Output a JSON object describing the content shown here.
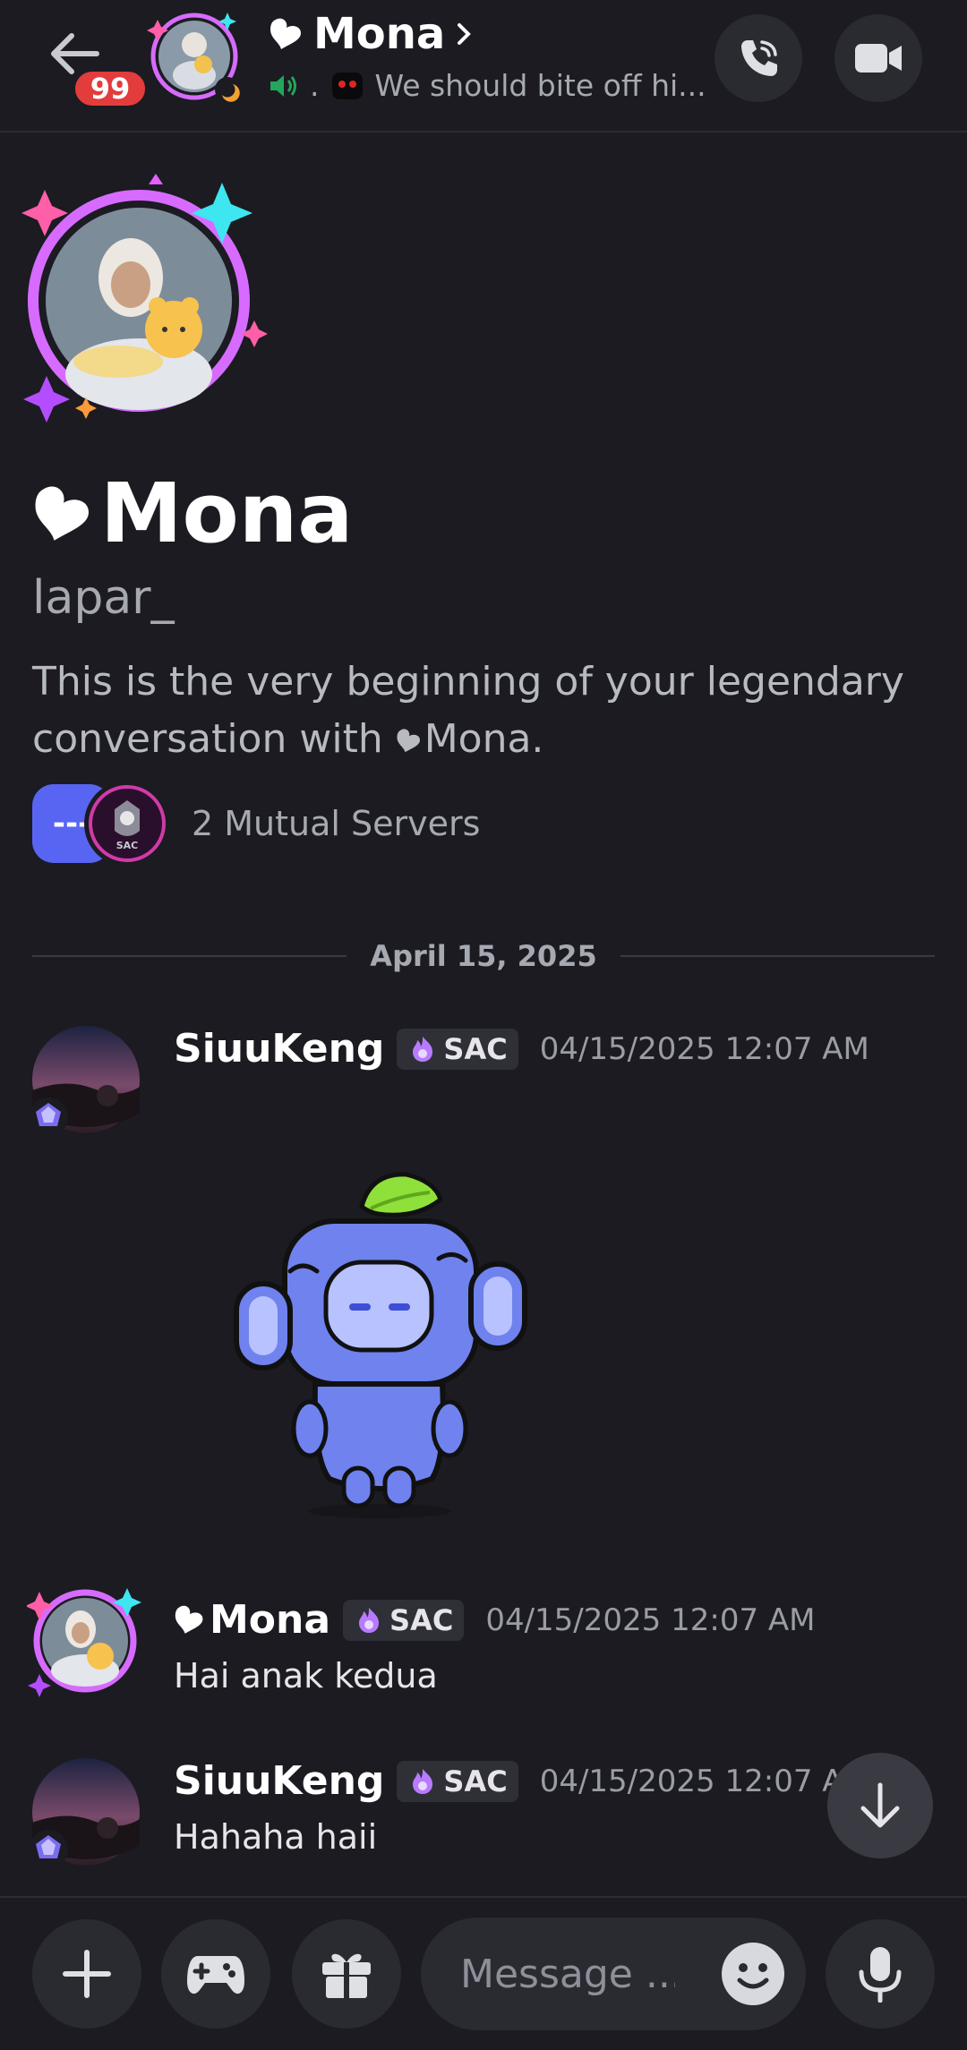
{
  "header": {
    "unread_badge": "99",
    "name": "Mona",
    "status_text": "We should bite off hi...",
    "status_sep": "."
  },
  "profile": {
    "name": "Mona",
    "username": "lapar_",
    "intro_prefix": "This is the very beginning of your legendary conversation with ",
    "intro_name": "Mona.",
    "mutual_servers": "2 Mutual Servers",
    "server1_label": "---"
  },
  "divider": {
    "date": "April 15, 2025"
  },
  "messages": [
    {
      "author": "SiuuKeng",
      "tag": "SAC",
      "timestamp": "04/15/2025 12:07 AM",
      "text": ""
    },
    {
      "author": "Mona",
      "tag": "SAC",
      "timestamp": "04/15/2025 12:07 AM",
      "text": "Hai anak kedua"
    },
    {
      "author": "SiuuKeng",
      "tag": "SAC",
      "timestamp": "04/15/2025 12:07 AM",
      "text": "Hahaha haii"
    }
  ],
  "composer": {
    "placeholder": "Message ..."
  },
  "icons": {
    "back": "arrow-left-icon",
    "call": "phone-icon",
    "video": "video-camera-icon",
    "plus": "plus-icon",
    "game": "gamepad-icon",
    "gift": "gift-icon",
    "emoji": "smiley-icon",
    "mic": "microphone-icon",
    "scroll": "arrow-down-icon"
  },
  "colors": {
    "background": "#1b1b21",
    "accent": "#5865f2",
    "badge": "#e23c3c",
    "online_speaker": "#23a55a"
  }
}
